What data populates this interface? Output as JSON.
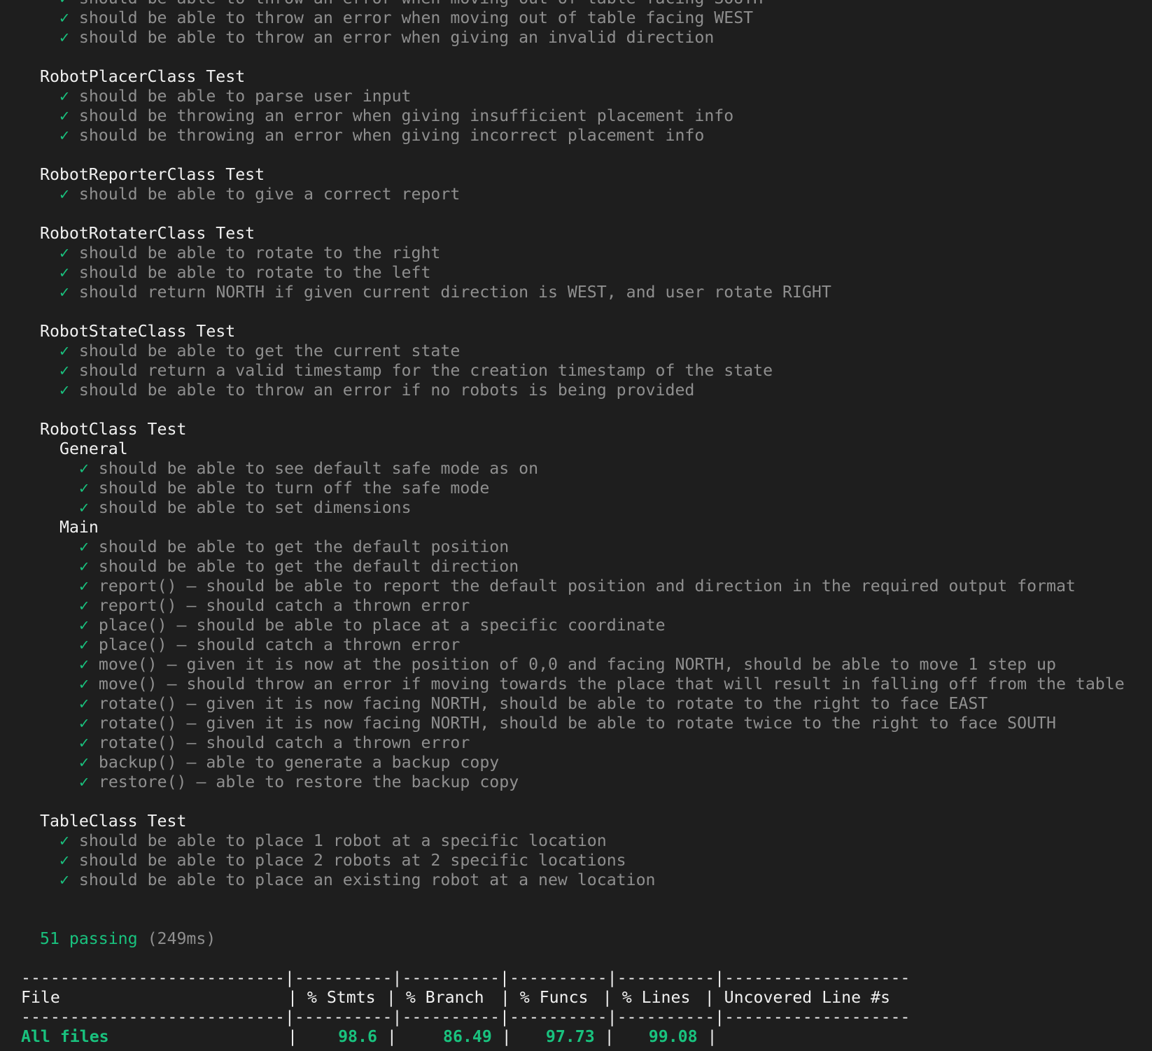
{
  "check_icon": "✓",
  "colors": {
    "background": "#1e1e1e",
    "pass": "#19c27e",
    "dim": "#8f8f8f",
    "text": "#f0f0f0"
  },
  "top_tests": [
    "should be able to throw an error when moving out of table facing SOUTH",
    "should be able to throw an error when moving out of table facing WEST",
    "should be able to throw an error when giving an invalid direction"
  ],
  "suites": {
    "placer": {
      "title": "RobotPlacerClass Test",
      "tests": [
        "should be able to parse user input",
        "should be throwing an error when giving insufficient placement info",
        "should be throwing an error when giving incorrect placement info"
      ]
    },
    "reporter": {
      "title": "RobotReporterClass Test",
      "tests": [
        "should be able to give a correct report"
      ]
    },
    "rotater": {
      "title": "RobotRotaterClass Test",
      "tests": [
        "should be able to rotate to the right",
        "should be able to rotate to the left",
        "should return NORTH if given current direction is WEST, and user rotate RIGHT"
      ]
    },
    "state": {
      "title": "RobotStateClass Test",
      "tests": [
        "should be able to get the current state",
        "should return a valid timestamp for the creation timestamp of the state",
        "should be able to throw an error if no robots is being provided"
      ]
    },
    "robot": {
      "title": "RobotClass Test",
      "general": {
        "title": "General",
        "tests": [
          "should be able to see default safe mode as on",
          "should be able to turn off the safe mode",
          "should be able to set dimensions"
        ]
      },
      "main": {
        "title": "Main",
        "tests": [
          "should be able to get the default position",
          "should be able to get the default direction",
          "report() – should be able to report the default position and direction in the required output format",
          "report() – should catch a thrown error",
          "place() – should be able to place at a specific coordinate",
          "place() – should catch a thrown error",
          "move() – given it is now at the position of 0,0 and facing NORTH, should be able to move 1 step up",
          "move() – should throw an error if moving towards the place that will result in falling off from the table",
          "rotate() – given it is now facing NORTH, should be able to rotate to the right to face EAST",
          "rotate() – given it is now facing NORTH, should be able to rotate twice to the right to face SOUTH",
          "rotate() – should catch a thrown error",
          "backup() – able to generate a backup copy",
          "restore() – able to restore the backup copy"
        ]
      }
    },
    "table": {
      "title": "TableClass Test",
      "tests": [
        "should be able to place 1 robot at a specific location",
        "should be able to place 2 robots at 2 specific locations",
        "should be able to place an existing robot at a new location"
      ]
    }
  },
  "summary": {
    "passing": "51 passing",
    "duration": "(249ms)"
  },
  "coverage": {
    "divider": "---------------------------|----------|----------|----------|----------|-------------------",
    "header": {
      "file": "File",
      "stmts": "% Stmts",
      "branch": "% Branch",
      "funcs": "% Funcs",
      "lines": "% Lines",
      "uncovered": "Uncovered Line #s"
    },
    "all_files": {
      "file": "All files",
      "stmts": "98.6",
      "branch": "86.49",
      "funcs": "97.73",
      "lines": "99.08",
      "uncovered": ""
    }
  }
}
